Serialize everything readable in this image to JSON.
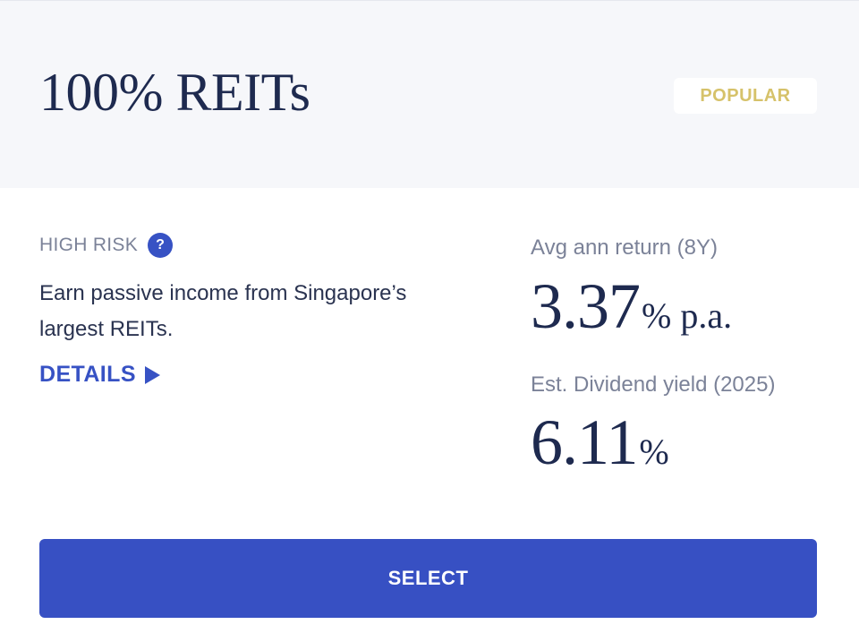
{
  "header": {
    "title": "100% REITs",
    "badge": "POPULAR"
  },
  "risk": {
    "label": "HIGH RISK",
    "help_icon_glyph": "?",
    "help_icon": "question-icon"
  },
  "description": "Earn passive income from Singapore’s largest REITs.",
  "details": {
    "label": "DETAILS",
    "icon": "play-icon"
  },
  "metrics": [
    {
      "label": "Avg ann return (8Y)",
      "value": "3.37",
      "unit": "% p.a."
    },
    {
      "label": "Est. Dividend yield (2025)",
      "value": "6.11",
      "unit": "%"
    }
  ],
  "action": {
    "select_label": "SELECT"
  },
  "colors": {
    "accent": "#3752c4",
    "badge_text": "#d6c26a",
    "header_bg": "#f6f7fa",
    "title_text": "#1e2a4f",
    "muted_text": "#7b8298"
  }
}
